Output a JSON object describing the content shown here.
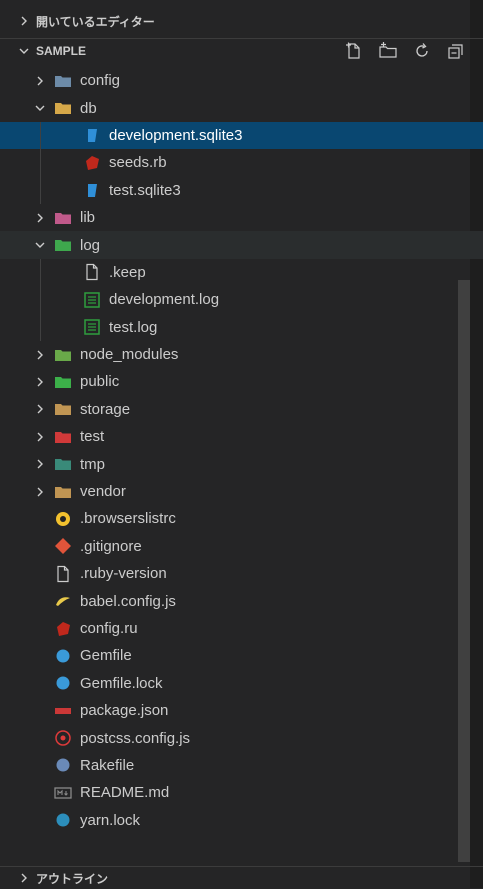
{
  "sections": {
    "open_editors": "開いているエディター",
    "explorer": "SAMPLE",
    "outline": "アウトライン"
  },
  "toolbar": {
    "new_file": "new-file-icon",
    "new_folder": "new-folder-icon",
    "refresh": "refresh-icon",
    "collapse": "collapse-all-icon"
  },
  "tree": [
    {
      "label": "config",
      "kind": "folder",
      "level": 0,
      "expanded": false,
      "icon": "config-folder-icon",
      "color": "#6d8ba8"
    },
    {
      "label": "db",
      "kind": "folder",
      "level": 0,
      "expanded": true,
      "icon": "db-folder-icon",
      "color": "#d6a84a"
    },
    {
      "label": "development.sqlite3",
      "kind": "file",
      "level": 1,
      "icon": "sqlite-icon",
      "color": "#2f8fd8",
      "selected": true
    },
    {
      "label": "seeds.rb",
      "kind": "file",
      "level": 1,
      "icon": "ruby-icon",
      "color": "#c0281c"
    },
    {
      "label": "test.sqlite3",
      "kind": "file",
      "level": 1,
      "icon": "sqlite-icon",
      "color": "#2f8fd8"
    },
    {
      "label": "lib",
      "kind": "folder",
      "level": 0,
      "expanded": false,
      "icon": "lib-folder-icon",
      "color": "#c05a8a"
    },
    {
      "label": "log",
      "kind": "folder",
      "level": 0,
      "expanded": true,
      "icon": "log-folder-icon",
      "color": "#3fa84e",
      "focused": true
    },
    {
      "label": ".keep",
      "kind": "file",
      "level": 1,
      "icon": "file-icon",
      "color": "#cccccc"
    },
    {
      "label": "development.log",
      "kind": "file",
      "level": 1,
      "icon": "log-file-icon",
      "color": "#2e9e3e"
    },
    {
      "label": "test.log",
      "kind": "file",
      "level": 1,
      "icon": "log-file-icon",
      "color": "#2e9e3e"
    },
    {
      "label": "node_modules",
      "kind": "folder",
      "level": 0,
      "expanded": false,
      "icon": "node-folder-icon",
      "color": "#6aa94a"
    },
    {
      "label": "public",
      "kind": "folder",
      "level": 0,
      "expanded": false,
      "icon": "public-folder-icon",
      "color": "#3cb04a"
    },
    {
      "label": "storage",
      "kind": "folder",
      "level": 0,
      "expanded": false,
      "icon": "folder-icon",
      "color": "#c09553"
    },
    {
      "label": "test",
      "kind": "folder",
      "level": 0,
      "expanded": false,
      "icon": "test-folder-icon",
      "color": "#d03a3a"
    },
    {
      "label": "tmp",
      "kind": "folder",
      "level": 0,
      "expanded": false,
      "icon": "tmp-folder-icon",
      "color": "#3a8a7a"
    },
    {
      "label": "vendor",
      "kind": "folder",
      "level": 0,
      "expanded": false,
      "icon": "folder-icon",
      "color": "#c09553"
    },
    {
      "label": ".browserslistrc",
      "kind": "file",
      "level": 0,
      "icon": "browserslist-icon",
      "color": "#f2c12e"
    },
    {
      "label": ".gitignore",
      "kind": "file",
      "level": 0,
      "icon": "git-icon",
      "color": "#e0543a"
    },
    {
      "label": ".ruby-version",
      "kind": "file",
      "level": 0,
      "icon": "file-icon",
      "color": "#cccccc"
    },
    {
      "label": "babel.config.js",
      "kind": "file",
      "level": 0,
      "icon": "babel-icon",
      "color": "#e8c94a"
    },
    {
      "label": "config.ru",
      "kind": "file",
      "level": 0,
      "icon": "ruby-icon",
      "color": "#c0281c"
    },
    {
      "label": "Gemfile",
      "kind": "file",
      "level": 0,
      "icon": "gemfile-icon",
      "color": "#3a9ad9"
    },
    {
      "label": "Gemfile.lock",
      "kind": "file",
      "level": 0,
      "icon": "gemfile-icon",
      "color": "#3a9ad9"
    },
    {
      "label": "package.json",
      "kind": "file",
      "level": 0,
      "icon": "npm-icon",
      "color": "#cb3837"
    },
    {
      "label": "postcss.config.js",
      "kind": "file",
      "level": 0,
      "icon": "postcss-icon",
      "color": "#dd3a3a"
    },
    {
      "label": "Rakefile",
      "kind": "file",
      "level": 0,
      "icon": "rake-icon",
      "color": "#6a8ab8"
    },
    {
      "label": "README.md",
      "kind": "file",
      "level": 0,
      "icon": "markdown-icon",
      "color": "#8a8a8a"
    },
    {
      "label": "yarn.lock",
      "kind": "file",
      "level": 0,
      "icon": "yarn-icon",
      "color": "#2c8ebb"
    }
  ]
}
